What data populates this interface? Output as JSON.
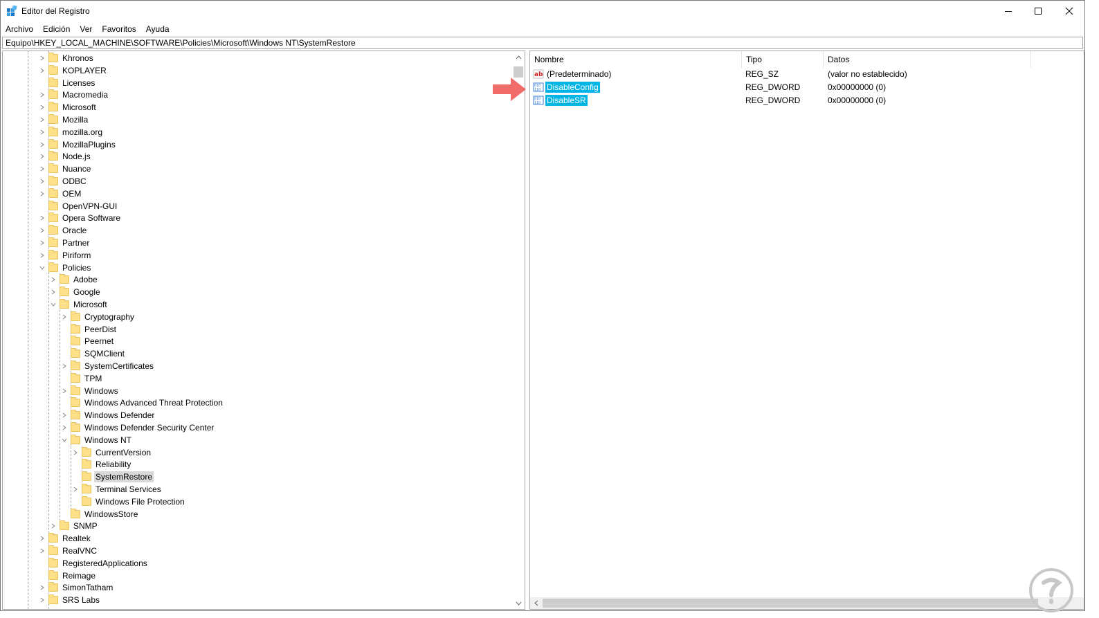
{
  "window": {
    "title": "Editor del Registro"
  },
  "menu": [
    "Archivo",
    "Edición",
    "Ver",
    "Favoritos",
    "Ayuda"
  ],
  "address": "Equipo\\HKEY_LOCAL_MACHINE\\SOFTWARE\\Policies\\Microsoft\\Windows NT\\SystemRestore",
  "tree": [
    {
      "label": "Khronos",
      "level": 0,
      "expander": "collapsed"
    },
    {
      "label": "KOPLAYER",
      "level": 0,
      "expander": "collapsed"
    },
    {
      "label": "Licenses",
      "level": 0,
      "expander": "none"
    },
    {
      "label": "Macromedia",
      "level": 0,
      "expander": "collapsed"
    },
    {
      "label": "Microsoft",
      "level": 0,
      "expander": "collapsed"
    },
    {
      "label": "Mozilla",
      "level": 0,
      "expander": "collapsed"
    },
    {
      "label": "mozilla.org",
      "level": 0,
      "expander": "collapsed"
    },
    {
      "label": "MozillaPlugins",
      "level": 0,
      "expander": "collapsed"
    },
    {
      "label": "Node.js",
      "level": 0,
      "expander": "collapsed"
    },
    {
      "label": "Nuance",
      "level": 0,
      "expander": "collapsed"
    },
    {
      "label": "ODBC",
      "level": 0,
      "expander": "collapsed"
    },
    {
      "label": "OEM",
      "level": 0,
      "expander": "collapsed"
    },
    {
      "label": "OpenVPN-GUI",
      "level": 0,
      "expander": "none"
    },
    {
      "label": "Opera Software",
      "level": 0,
      "expander": "collapsed"
    },
    {
      "label": "Oracle",
      "level": 0,
      "expander": "collapsed"
    },
    {
      "label": "Partner",
      "level": 0,
      "expander": "collapsed"
    },
    {
      "label": "Piriform",
      "level": 0,
      "expander": "collapsed"
    },
    {
      "label": "Policies",
      "level": 0,
      "expander": "expanded"
    },
    {
      "label": "Adobe",
      "level": 1,
      "expander": "collapsed"
    },
    {
      "label": "Google",
      "level": 1,
      "expander": "collapsed"
    },
    {
      "label": "Microsoft",
      "level": 1,
      "expander": "expanded"
    },
    {
      "label": "Cryptography",
      "level": 2,
      "expander": "collapsed"
    },
    {
      "label": "PeerDist",
      "level": 2,
      "expander": "none"
    },
    {
      "label": "Peernet",
      "level": 2,
      "expander": "none"
    },
    {
      "label": "SQMClient",
      "level": 2,
      "expander": "none"
    },
    {
      "label": "SystemCertificates",
      "level": 2,
      "expander": "collapsed"
    },
    {
      "label": "TPM",
      "level": 2,
      "expander": "none"
    },
    {
      "label": "Windows",
      "level": 2,
      "expander": "collapsed"
    },
    {
      "label": "Windows Advanced Threat Protection",
      "level": 2,
      "expander": "none"
    },
    {
      "label": "Windows Defender",
      "level": 2,
      "expander": "collapsed"
    },
    {
      "label": "Windows Defender Security Center",
      "level": 2,
      "expander": "collapsed"
    },
    {
      "label": "Windows NT",
      "level": 2,
      "expander": "expanded"
    },
    {
      "label": "CurrentVersion",
      "level": 3,
      "expander": "collapsed"
    },
    {
      "label": "Reliability",
      "level": 3,
      "expander": "none"
    },
    {
      "label": "SystemRestore",
      "level": 3,
      "expander": "none",
      "selected": true
    },
    {
      "label": "Terminal Services",
      "level": 3,
      "expander": "collapsed"
    },
    {
      "label": "Windows File Protection",
      "level": 3,
      "expander": "none"
    },
    {
      "label": "WindowsStore",
      "level": 2,
      "expander": "none"
    },
    {
      "label": "SNMP",
      "level": 1,
      "expander": "collapsed"
    },
    {
      "label": "Realtek",
      "level": 0,
      "expander": "collapsed"
    },
    {
      "label": "RealVNC",
      "level": 0,
      "expander": "collapsed"
    },
    {
      "label": "RegisteredApplications",
      "level": 0,
      "expander": "none"
    },
    {
      "label": "Reimage",
      "level": 0,
      "expander": "none"
    },
    {
      "label": "SimonTatham",
      "level": 0,
      "expander": "collapsed"
    },
    {
      "label": "SRS Labs",
      "level": 0,
      "expander": "collapsed"
    }
  ],
  "list": {
    "columns": {
      "name": "Nombre",
      "type": "Tipo",
      "data": "Datos"
    },
    "rows": [
      {
        "name": "(Predeterminado)",
        "type": "REG_SZ",
        "data": "(valor no establecido)",
        "icon": "string-value-icon",
        "highlight": false
      },
      {
        "name": "DisableConfig",
        "type": "REG_DWORD",
        "data": "0x00000000 (0)",
        "icon": "dword-value-icon",
        "highlight": true
      },
      {
        "name": "DisableSR",
        "type": "REG_DWORD",
        "data": "0x00000000 (0)",
        "icon": "dword-value-icon",
        "highlight": true
      }
    ]
  },
  "colors": {
    "highlight": "#00b4e6",
    "arrow": "#f26b6b",
    "folder": "#ffe08a"
  }
}
